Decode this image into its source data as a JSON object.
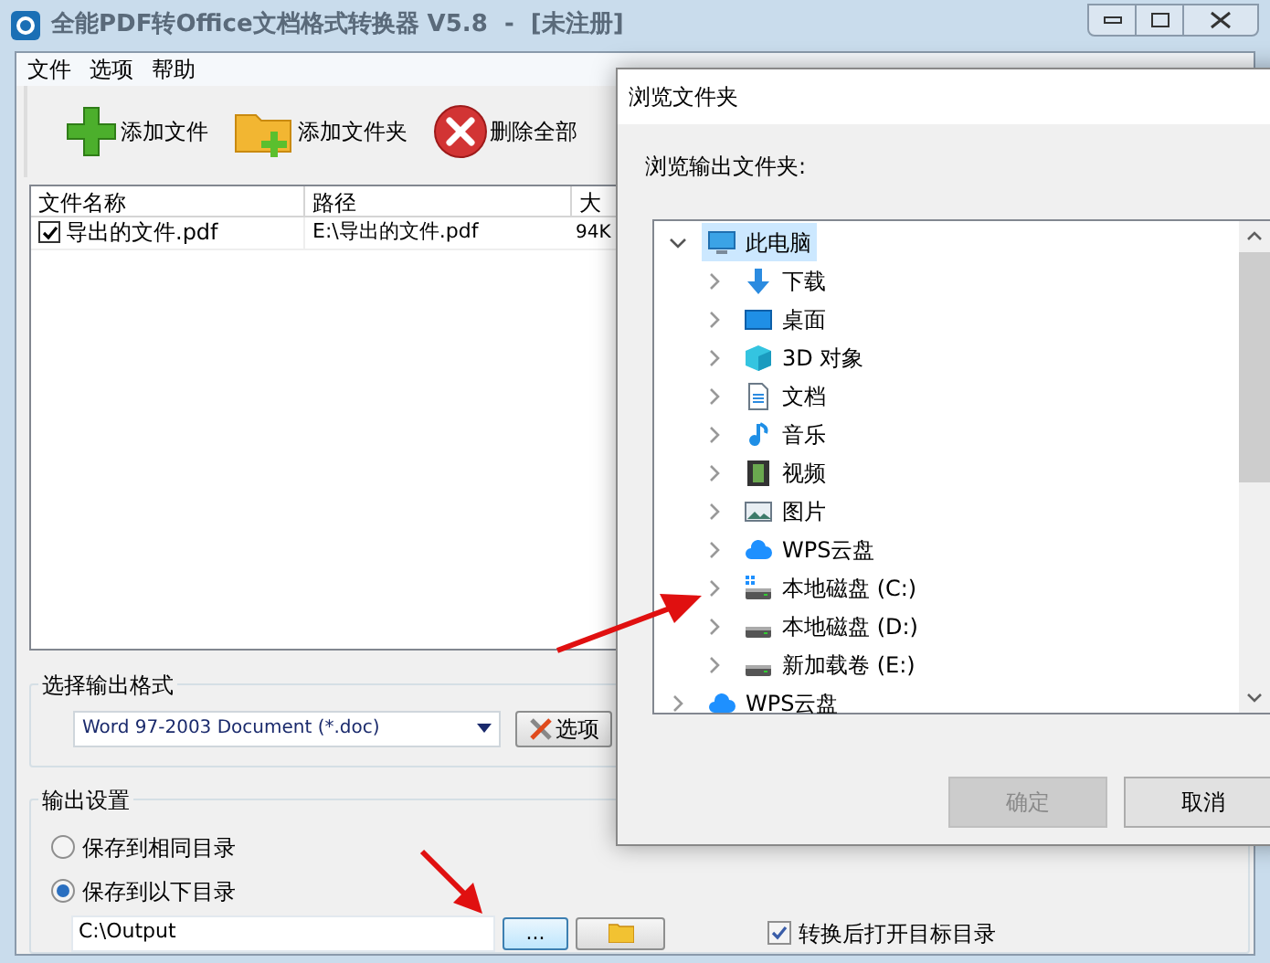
{
  "window": {
    "title": "全能PDF转Office文档格式转换器 V5.8  -  [未注册]"
  },
  "menu": [
    "文件",
    "选项",
    "帮助"
  ],
  "toolbar": [
    {
      "kind": "add-file",
      "label": "添加文件"
    },
    {
      "kind": "add-folder",
      "label": "添加文件夹"
    },
    {
      "kind": "delete-all",
      "label": "删除全部"
    }
  ],
  "file_table": {
    "columns": [
      "文件名称",
      "路径",
      "大"
    ],
    "rows": [
      {
        "checked": true,
        "name": "导出的文件.pdf",
        "path": "E:\\导出的文件.pdf",
        "size": "94K"
      }
    ]
  },
  "output_format": {
    "legend": "选择输出格式",
    "value": "Word 97-2003 Document (*.doc)",
    "options_button": "选项"
  },
  "output_settings": {
    "legend": "输出设置",
    "radios": [
      {
        "label": "保存到相同目录",
        "selected": false
      },
      {
        "label": "保存到以下目录",
        "selected": true
      }
    ],
    "path_value": "C:\\Output",
    "browse_button": "...",
    "open_after": {
      "label": "转换后打开目标目录",
      "checked": true
    }
  },
  "dialog": {
    "title": "浏览文件夹",
    "prompt": "浏览输出文件夹:",
    "tree": [
      {
        "label": "此电脑",
        "kind": "pc",
        "expanded": true,
        "selected": true,
        "children": [
          {
            "label": "下载",
            "kind": "download",
            "expanded": false,
            "selected": false
          },
          {
            "label": "桌面",
            "kind": "desktop",
            "expanded": false,
            "selected": false
          },
          {
            "label": "3D 对象",
            "kind": "cube",
            "expanded": false,
            "selected": false
          },
          {
            "label": "文档",
            "kind": "document",
            "expanded": false,
            "selected": false
          },
          {
            "label": "音乐",
            "kind": "music",
            "expanded": false,
            "selected": false
          },
          {
            "label": "视频",
            "kind": "video",
            "expanded": false,
            "selected": false
          },
          {
            "label": "图片",
            "kind": "picture",
            "expanded": false,
            "selected": false
          },
          {
            "label": "WPS云盘",
            "kind": "cloud",
            "expanded": false,
            "selected": false
          },
          {
            "label": "本地磁盘 (C:)",
            "kind": "system-drive",
            "expanded": false,
            "selected": false
          },
          {
            "label": "本地磁盘 (D:)",
            "kind": "drive",
            "expanded": false,
            "selected": false
          },
          {
            "label": "新加载卷 (E:)",
            "kind": "drive",
            "expanded": false,
            "selected": false
          }
        ]
      },
      {
        "label": "WPS云盘",
        "kind": "cloud",
        "expanded": false,
        "selected": false
      }
    ],
    "buttons": [
      {
        "label": "确定",
        "disabled": true
      },
      {
        "label": "取消",
        "disabled": false
      }
    ]
  }
}
